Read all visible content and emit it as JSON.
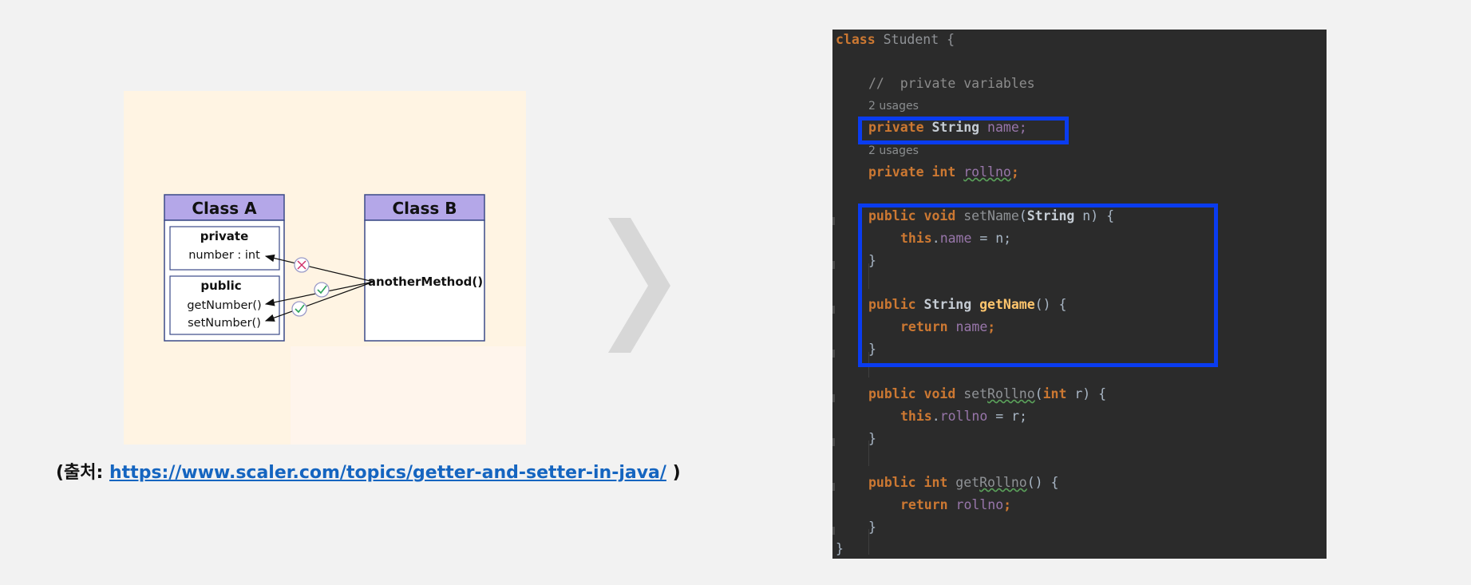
{
  "diagram": {
    "class_a": {
      "title": "Class A",
      "private_label": "private",
      "private_field": "number : int",
      "public_label": "public",
      "public_methods": [
        "getNumber()",
        "setNumber()"
      ]
    },
    "class_b": {
      "title": "Class B",
      "method": "anotherMethod()"
    },
    "access_marks": [
      "denied",
      "allowed",
      "allowed"
    ]
  },
  "source": {
    "prefix": "(출처: ",
    "url_text": "https://www.scaler.com/topics/getter-and-setter-in-java/",
    "suffix": " )"
  },
  "colors": {
    "header_fill": "#b4a7e8",
    "box_stroke": "#3b4a88",
    "highlight": "#0a3cf0",
    "editor_bg": "#2b2b2b",
    "keyword": "#cc7832",
    "field": "#9876aa",
    "link": "#1565c0"
  },
  "code": {
    "usages_a": "2 usages",
    "usages_b": "2 usages",
    "l01": [
      "class",
      " Student {"
    ],
    "l02": "//  private variables",
    "l03": [
      "private",
      " String ",
      "name;"
    ],
    "l04": [
      "private",
      " int ",
      "rollno",
      ";"
    ],
    "l05": [
      "public",
      " ",
      "void",
      " ",
      "setName",
      "(",
      "String",
      " n) {"
    ],
    "l06": [
      "this",
      ".",
      "name",
      " = n;"
    ],
    "l07": "}",
    "l08": [
      "public",
      " ",
      "String",
      " ",
      "getName",
      "() {"
    ],
    "l09": [
      "return",
      " ",
      "name",
      ";"
    ],
    "l10": "}",
    "l11": [
      "public",
      " ",
      "void",
      " set",
      "Rollno",
      "(",
      "int",
      " r) {"
    ],
    "l12": [
      "this",
      ".",
      "rollno",
      " = r;"
    ],
    "l13": "}",
    "l14": [
      "public",
      " ",
      "int",
      " get",
      "Rollno",
      "() {"
    ],
    "l15": [
      "return",
      " ",
      "rollno",
      ";"
    ],
    "l16": "}",
    "l17": "}"
  }
}
